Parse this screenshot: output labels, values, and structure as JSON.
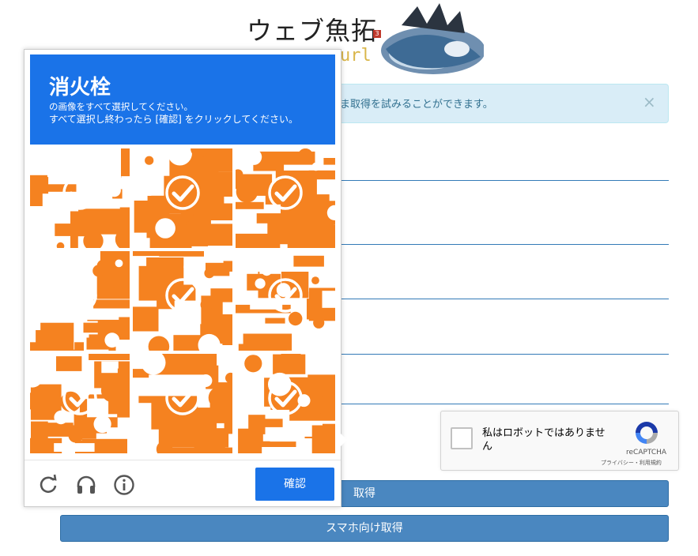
{
  "page": {
    "logo_text": "ウェブ魚拓",
    "logo_badge": "3",
    "logo_sub": "url",
    "alert_text": "ま取得を試みることができます。",
    "alert_close": "×",
    "get_button": "取得",
    "mobile_get_button": "スマホ向け取得"
  },
  "recaptcha": {
    "label": "私はロボットではありません",
    "brand": "reCAPTCHA",
    "links": "プライバシー・利用規約",
    "icon": "recaptcha-logo-icon"
  },
  "challenge": {
    "target": "消火栓",
    "instruction_line1": "の画像をすべて選択してください。",
    "instruction_line2": "すべて選択し終わったら [確認] をクリックしてください。",
    "tiles_selected": [
      true,
      true,
      true,
      true,
      true,
      true,
      true,
      true,
      true
    ],
    "verify_button": "確認",
    "footer_icons": [
      "reload-icon",
      "audio-icon",
      "info-icon"
    ]
  },
  "colors": {
    "header_blue": "#1a73e8",
    "tile_orange": "#f58220",
    "button_blue": "#4a87c0",
    "alert_bg": "#d9edf7"
  }
}
